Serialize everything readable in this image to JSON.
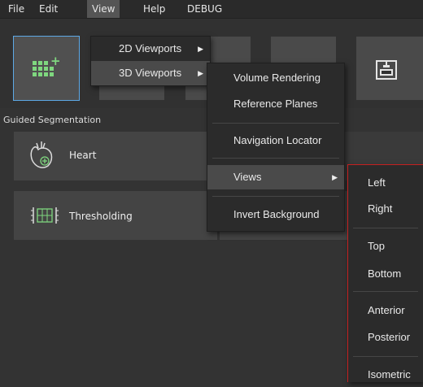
{
  "menubar": {
    "items": [
      {
        "label": "File"
      },
      {
        "label": "Edit"
      },
      {
        "label": "View"
      },
      {
        "label": "Help"
      },
      {
        "label": "DEBUG"
      }
    ]
  },
  "view_menu": {
    "items": [
      {
        "label": "2D Viewports"
      },
      {
        "label": "3D Viewports"
      }
    ]
  },
  "viewports3d_menu": {
    "items": [
      {
        "label": "Volume Rendering"
      },
      {
        "label": "Reference Planes"
      },
      {
        "label": "Navigation Locator"
      },
      {
        "label": "Views"
      },
      {
        "label": "Invert Background"
      }
    ]
  },
  "views_menu": {
    "items": [
      {
        "label": "Left"
      },
      {
        "label": "Right"
      },
      {
        "label": "Top"
      },
      {
        "label": "Bottom"
      },
      {
        "label": "Anterior"
      },
      {
        "label": "Posterior"
      },
      {
        "label": "Isometric"
      }
    ]
  },
  "panel": {
    "title": "Guided Segmentation",
    "items": [
      {
        "label": "Heart",
        "icon": "heart-icon"
      },
      {
        "label": "Thresholding",
        "icon": "thresholding-icon"
      }
    ]
  },
  "colors": {
    "accent_selection": "#5da9e6",
    "submenu_border": "#c42020",
    "icon_green": "#7fd77f"
  }
}
